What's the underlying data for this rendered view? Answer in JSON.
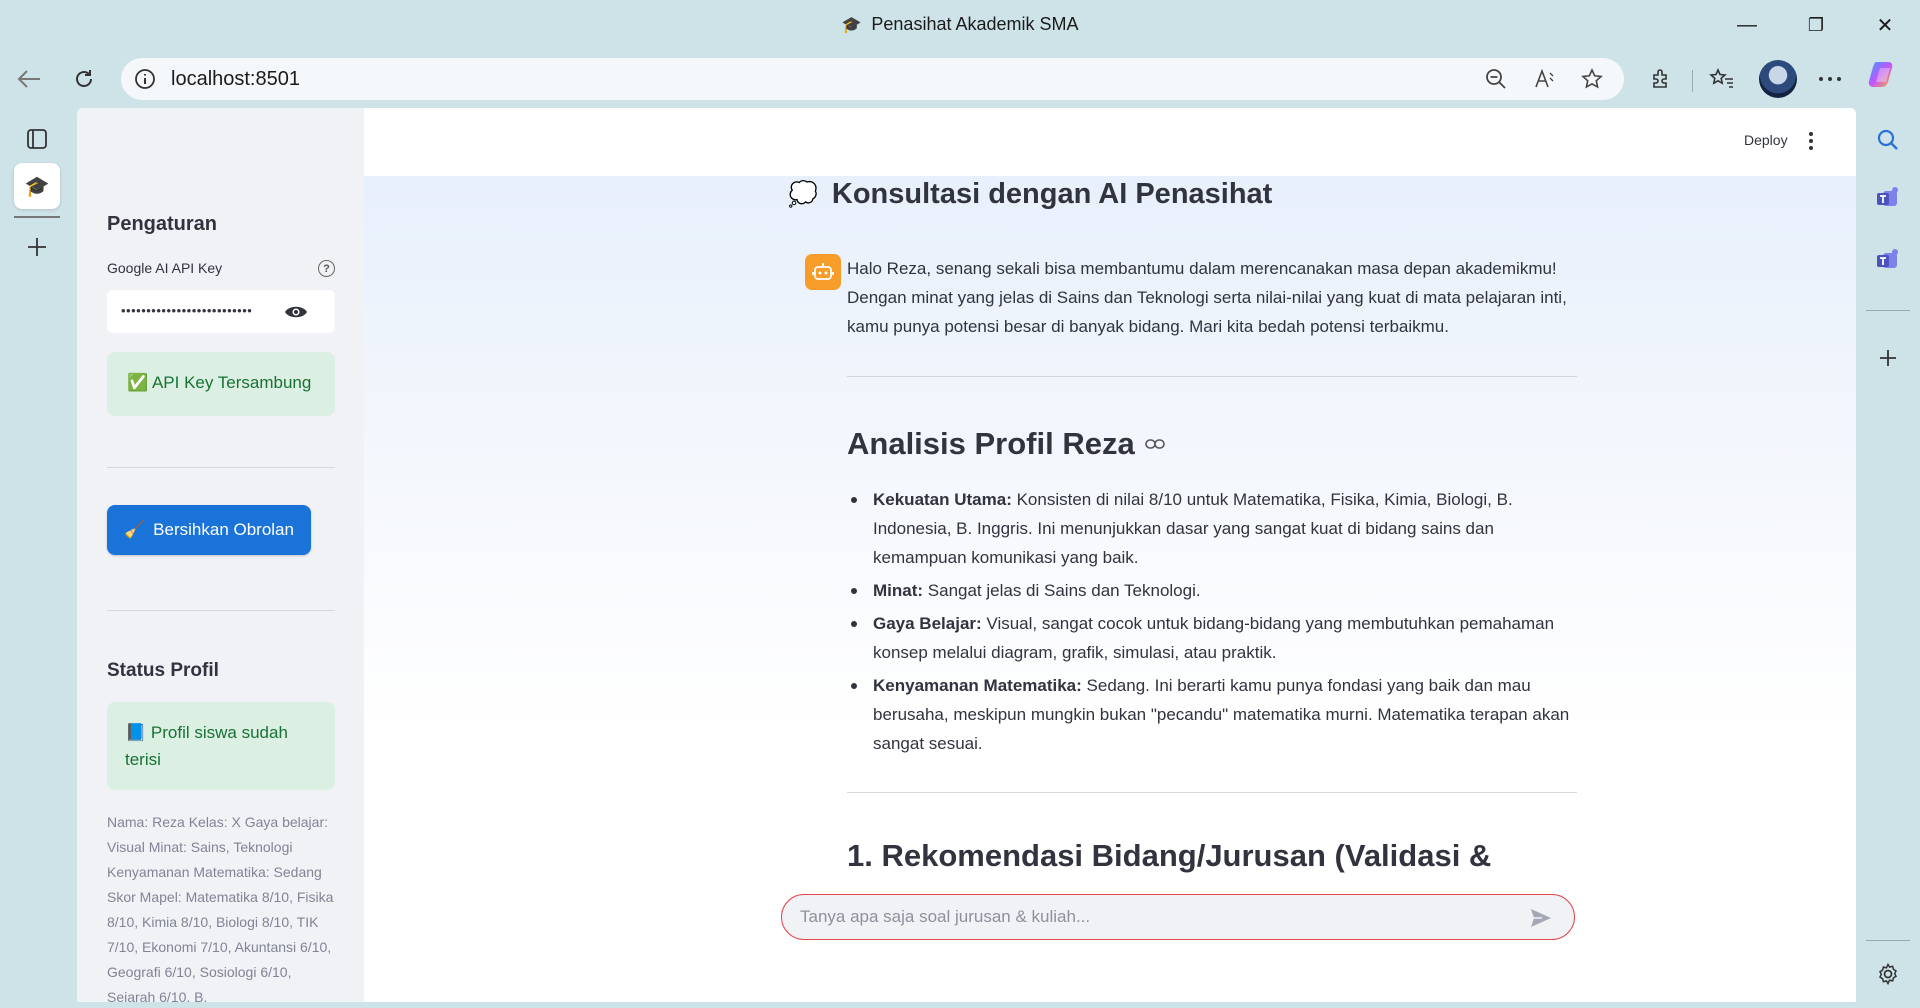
{
  "window": {
    "title": "Penasihat Akademik SMA",
    "minimize_glyph": "—",
    "maximize_glyph": "❐",
    "close_glyph": "✕"
  },
  "browser": {
    "url": "localhost:8501",
    "back_icon": "back-arrow-icon",
    "refresh_icon": "refresh-icon"
  },
  "app": {
    "header": {
      "deploy_label": "Deploy"
    },
    "sidebar": {
      "settings_heading": "Pengaturan",
      "api_key_label": "Google AI API Key",
      "api_key_value": "••••••••••••••••••••••••••",
      "api_status": "✅ API Key Tersambung",
      "clear_button_icon": "🧹",
      "clear_button_label": "Bersihkan Obrolan",
      "profile_heading": "Status Profil",
      "profile_status": "📘 Profil siswa sudah terisi",
      "profile_detail": "Nama: Reza Kelas: X Gaya belajar: Visual Minat: Sains, Teknologi Kenyamanan Matematika: Sedang Skor Mapel: Matematika 8/10, Fisika 8/10, Kimia 8/10, Biologi 8/10, TIK 7/10, Ekonomi 7/10, Akuntansi 6/10, Geografi 6/10, Sosiologi 6/10, Sejarah 6/10, B."
    },
    "main": {
      "chat_title_icon": "💭",
      "chat_title": "Konsultasi dengan AI Penasihat",
      "message_intro": "Halo Reza, senang sekali bisa membantumu dalam merencanakan masa depan akademikmu! Dengan minat yang jelas di Sains dan Teknologi serta nilai-nilai yang kuat di mata pelajaran inti, kamu punya potensi besar di banyak bidang. Mari kita bedah potensi terbaikmu.",
      "section1_title": "Analisis Profil Reza",
      "bullets": [
        {
          "label": "Kekuatan Utama:",
          "text": " Konsisten di nilai 8/10 untuk Matematika, Fisika, Kimia, Biologi, B. Indonesia, B. Inggris. Ini menunjukkan dasar yang sangat kuat di bidang sains dan kemampuan komunikasi yang baik."
        },
        {
          "label": "Minat:",
          "text": " Sangat jelas di Sains dan Teknologi."
        },
        {
          "label": "Gaya Belajar:",
          "text": " Visual, sangat cocok untuk bidang-bidang yang membutuhkan pemahaman konsep melalui diagram, grafik, simulasi, atau praktik."
        },
        {
          "label": "Kenyamanan Matematika:",
          "text": " Sedang. Ini berarti kamu punya fondasi yang baik dan mau berusaha, meskipun mungkin bukan \"pecandu\" matematika murni. Matematika terapan akan sangat sesuai."
        }
      ],
      "section2_title": "1. Rekomendasi Bidang/Jurusan (Validasi &",
      "chat_input_placeholder": "Tanya apa saja soal jurusan & kuliah..."
    }
  },
  "colors": {
    "primary_button": "#1a73d9",
    "success_bg": "#dcefe3",
    "success_text": "#177233",
    "input_border_focus": "#e0464b",
    "assistant_avatar": "#f89c2a"
  }
}
